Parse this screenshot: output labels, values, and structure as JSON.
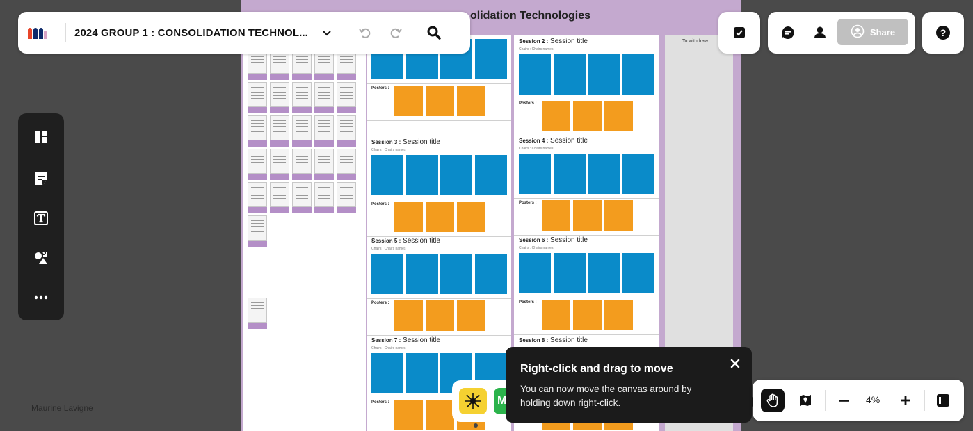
{
  "app": {
    "board_name": "2024 GROUP 1 : CONSOLIDATION TECHNOL..."
  },
  "toolbar": {
    "share_label": "Share"
  },
  "canvas": {
    "board_title": "olidation Technologies",
    "withdraw_label": "To withdraw",
    "author_label": "Maurine Lavigne",
    "posters_label": "Posters :",
    "sessions": [
      {
        "number": "Session 2 :",
        "title": "Session title",
        "chairs": "Chairs :   Chairs names"
      },
      {
        "number": "Session 3 :",
        "title": "Session title",
        "chairs": "Chairs :   Chairs names"
      },
      {
        "number": "Session 4 :",
        "title": "Session title",
        "chairs": "Chairs :   Chairs names"
      },
      {
        "number": "Session 5 :",
        "title": "Session title",
        "chairs": "Chairs :   Chairs names"
      },
      {
        "number": "Session 6 :",
        "title": "Session title",
        "chairs": "Chairs :   Chairs names"
      },
      {
        "number": "Session 7 :",
        "title": "Session title",
        "chairs": "Chairs :   Chairs names"
      },
      {
        "number": "Session 8 :",
        "title": "Session title",
        "chairs": ""
      }
    ]
  },
  "tooltip": {
    "title": "Right-click and drag to move",
    "body": "You can now move the canvas around by holding down right-click."
  },
  "zoom": {
    "level": "4%"
  },
  "app_tray": {
    "green_app_letter": "M"
  },
  "colors": {
    "abstract_tile": "#0a8bc9",
    "poster_tile": "#f39c1e",
    "board_background": "#c4a9cf",
    "tooltip_background": "#1b1b1b",
    "share_disabled": "#c0c0c0"
  },
  "icons": {
    "logo": "miro-logo-icon",
    "dropdown": "chevron-down-icon",
    "undo": "undo-icon",
    "redo": "redo-icon",
    "search": "search-icon",
    "checkbox": "check-square-icon",
    "comments": "chat-icon",
    "user": "user-icon",
    "share_avatar": "add-user-icon",
    "help": "question-circle-icon",
    "templates": "layout-icon",
    "sticky_note": "sticky-note-icon",
    "text": "text-tool-icon",
    "shapes": "shapes-icon",
    "more": "more-dots-icon",
    "hand": "hand-pan-icon",
    "map": "map-pin-icon",
    "zoom_out": "minus-icon",
    "zoom_in": "plus-icon",
    "panel_toggle": "panel-toggle-icon",
    "close": "close-icon",
    "spider_app": "spider-app-icon"
  }
}
